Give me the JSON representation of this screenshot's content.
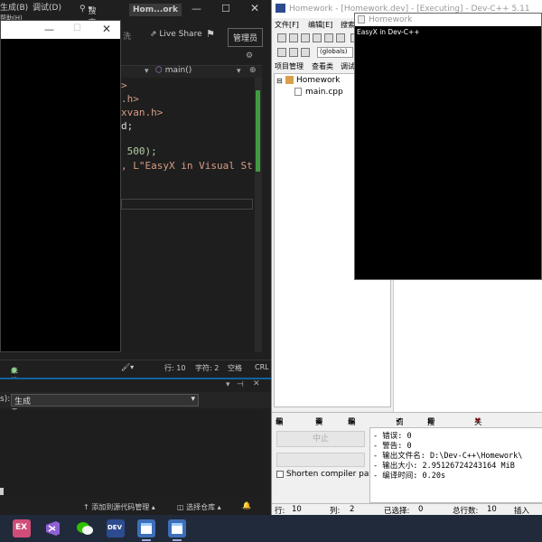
{
  "vs": {
    "menu": {
      "build": "生成(B)",
      "debug": "调试(D)",
      "help": "帮助(H)",
      "search": "搜索",
      "title": "Hom...ork"
    },
    "toolbar": {
      "live_share": "Live Share",
      "admin": "管理员"
    },
    "nav": {
      "function": "main()"
    },
    "code_lines": [
      ">",
      ".h>",
      "xvan.h>",
      "d;",
      "",
      " 500);",
      ", L\"EasyX in Visual St"
    ],
    "status": {
      "no_issues": "未找到相关问题",
      "line": "行: 10",
      "char": "字符: 2",
      "space": "空格",
      "crlf": "CRL"
    },
    "output": {
      "source_label": "s):",
      "source_value": "生成"
    },
    "bottom": {
      "add_source": "添加到源代码管理",
      "select_repo": "选择仓库"
    }
  },
  "dev": {
    "title": "Homework - [Homework.dev] - [Executing] - Dev-C++ 5.11",
    "menu": [
      "文件[F]",
      "编辑[E]",
      "搜索"
    ],
    "globals": "(globals)",
    "tabs": [
      "项目管理",
      "查看类",
      "调试"
    ],
    "tree": {
      "project": "Homework",
      "file": "main.cpp"
    },
    "program_window": {
      "title": "Homework",
      "text": "EasyX in Dev-C++"
    },
    "bottom_tabs": [
      "编译器",
      "资源",
      "编译日志",
      "调试",
      "搜索结果",
      "关闭"
    ],
    "stop_button": "中止",
    "shorten_label": "Shorten compiler pat",
    "log_lines": [
      "- 错误: 0",
      "- 警告: 0",
      "- 输出文件名: D:\\Dev-C++\\Homework\\",
      "- 输出大小: 2.95126724243164 MiB",
      "- 编译时间: 0.20s"
    ],
    "status": {
      "line_label": "行:",
      "line": "10",
      "col_label": "列:",
      "col": "2",
      "selected_label": "已选择:",
      "selected": "0",
      "total_label": "总行数:",
      "total": "10",
      "insert": "插入"
    }
  },
  "taskbar": {
    "items": [
      "easyx",
      "visual-studio",
      "wechat",
      "dev-cpp",
      "window-1",
      "window-2"
    ]
  },
  "colors": {
    "vs_accent": "#0e639c",
    "scroll_green": "#3f9b3f",
    "taskbar": "#202a3a"
  }
}
